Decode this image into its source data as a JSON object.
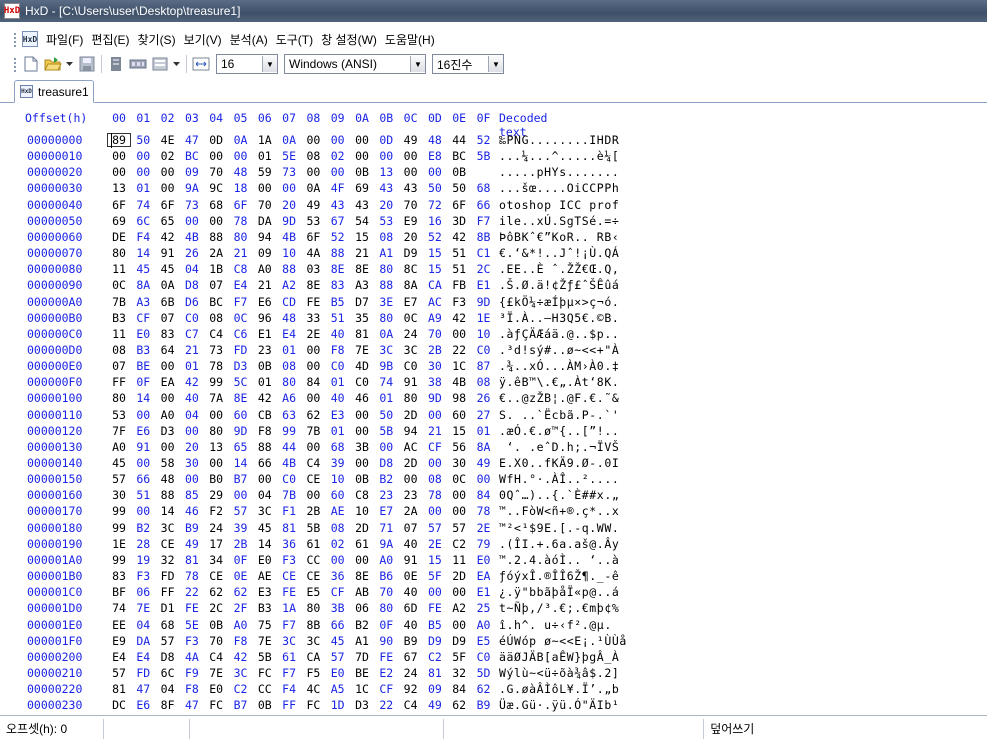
{
  "window": {
    "title": "HxD - [C:\\Users\\user\\Desktop\\treasure1]",
    "app_icon_text": "HxD"
  },
  "menu": {
    "icon_text": "HxD",
    "items": [
      "파일(F)",
      "편집(E)",
      "찾기(S)",
      "보기(V)",
      "분석(A)",
      "도구(T)",
      "창 설정(W)",
      "도움말(H)"
    ]
  },
  "toolbar": {
    "bytes_per_row": "16",
    "charset": "Windows (ANSI)",
    "number_base": "16진수"
  },
  "tabs": [
    {
      "label": "treasure1"
    }
  ],
  "editor": {
    "header": {
      "offset_label": "Offset(h)",
      "columns": [
        "00",
        "01",
        "02",
        "03",
        "04",
        "05",
        "06",
        "07",
        "08",
        "09",
        "0A",
        "0B",
        "0C",
        "0D",
        "0E",
        "0F"
      ],
      "decoded_label": "Decoded text"
    },
    "rows": [
      {
        "offset": "00000000",
        "bytes": "89 50 4E 47 0D 0A 1A 0A 00 00 00 0D 49 48 44 52",
        "text": "‰PNG........IHDR"
      },
      {
        "offset": "00000010",
        "bytes": "00 00 02 BC 00 00 01 5E 08 02 00 00 00 E8 BC 5B",
        "text": "...¼...^.....è¼["
      },
      {
        "offset": "00000020",
        "bytes": "00 00 00 09 70 48 59 73 00 00 0B 13 00 00 0B",
        "text": ".....pHYs......."
      },
      {
        "offset": "00000030",
        "bytes": "13 01 00 9A 9C 18 00 00 0A 4F 69 43 43 50 50 68",
        "text": "...šœ....OiCCPPh"
      },
      {
        "offset": "00000040",
        "bytes": "6F 74 6F 73 68 6F 70 20 49 43 43 20 70 72 6F 66",
        "text": "otoshop ICC prof"
      },
      {
        "offset": "00000050",
        "bytes": "69 6C 65 00 00 78 DA 9D 53 67 54 53 E9 16 3D F7",
        "text": "ile..xÚ.SgTSé.=÷"
      },
      {
        "offset": "00000060",
        "bytes": "DE F4 42 4B 88 80 94 4B 6F 52 15 08 20 52 42 8B",
        "text": "ÞôBKˆ€”KoR.. RB‹"
      },
      {
        "offset": "00000070",
        "bytes": "80 14 91 26 2A 21 09 10 4A 88 21 A1 D9 15 51 C1",
        "text": "€.‘&*!..Jˆ!¡Ù.QÁ"
      },
      {
        "offset": "00000080",
        "bytes": "11 45 45 04 1B C8 A0 88 03 8E 8E 80 8C 15 51 2C",
        "text": ".EE..È ˆ.ŽŽ€Œ.Q,"
      },
      {
        "offset": "00000090",
        "bytes": "0C 8A 0A D8 07 E4 21 A2 8E 83 A3 88 8A CA FB E1",
        "text": ".Š.Ø.ä!¢Žƒ£ˆŠÊûá"
      },
      {
        "offset": "000000A0",
        "bytes": "7B A3 6B D6 BC F7 E6 CD FE B5 D7 3E E7 AC F3 9D",
        "text": "{£kÖ¼÷æÍþµ×>ç¬ó."
      },
      {
        "offset": "000000B0",
        "bytes": "B3 CF 07 C0 08 0C 96 48 33 51 35 80 0C A9 42 1E",
        "text": "³Ï.À..–H3Q5€.©B."
      },
      {
        "offset": "000000C0",
        "bytes": "11 E0 83 C7 C4 C6 E1 E4 2E 40 81 0A 24 70 00 10",
        "text": ".àƒÇÄÆáä.@..$p.."
      },
      {
        "offset": "000000D0",
        "bytes": "08 B3 64 21 73 FD 23 01 00 F8 7E 3C 3C 2B 22 C0",
        "text": ".³d!sý#..ø~<<+\"À"
      },
      {
        "offset": "000000E0",
        "bytes": "07 BE 00 01 78 D3 0B 08 00 C0 4D 9B C0 30 1C 87",
        "text": ".¾..xÓ...ÀM›À0.‡"
      },
      {
        "offset": "000000F0",
        "bytes": "FF 0F EA 42 99 5C 01 80 84 01 C0 74 91 38 4B 08",
        "text": "ÿ.êB™\\.€„.Àt‘8K."
      },
      {
        "offset": "00000100",
        "bytes": "80 14 00 40 7A 8E 42 A6 00 40 46 01 80 9D 98 26",
        "text": "€..@zŽB¦.@F.€.˜&"
      },
      {
        "offset": "00000110",
        "bytes": "53 00 A0 04 00 60 CB 63 62 E3 00 50 2D 00 60 27",
        "text": "S. ..`Ëcbã.P-.`'"
      },
      {
        "offset": "00000120",
        "bytes": "7F E6 D3 00 80 9D F8 99 7B 01 00 5B 94 21 15 01",
        "text": ".æÓ.€.ø™{..[”!.."
      },
      {
        "offset": "00000130",
        "bytes": "A0 91 00 20 13 65 88 44 00 68 3B 00 AC CF 56 8A",
        "text": " ‘. .eˆD.h;.¬ÏVŠ"
      },
      {
        "offset": "00000140",
        "bytes": "45 00 58 30 00 14 66 4B C4 39 00 D8 2D 00 30 49",
        "text": "E.X0..fKÄ9.Ø-.0I"
      },
      {
        "offset": "00000150",
        "bytes": "57 66 48 00 B0 B7 00 C0 CE 10 0B B2 00 08 0C 00",
        "text": "WfH.°·.ÀÎ..²...."
      },
      {
        "offset": "00000160",
        "bytes": "30 51 88 85 29 00 04 7B 00 60 C8 23 23 78 00 84",
        "text": "0Qˆ…)..{.`È##x.„"
      },
      {
        "offset": "00000170",
        "bytes": "99 00 14 46 F2 57 3C F1 2B AE 10 E7 2A 00 00 78",
        "text": "™..FòW<ñ+®.ç*..x"
      },
      {
        "offset": "00000180",
        "bytes": "99 B2 3C B9 24 39 45 81 5B 08 2D 71 07 57 57 2E",
        "text": "™²<¹$9E.[.-q.WW."
      },
      {
        "offset": "00000190",
        "bytes": "1E 28 CE 49 17 2B 14 36 61 02 61 9A 40 2E C2 79",
        "text": ".(ÎI.+.6a.aš@.Ây"
      },
      {
        "offset": "000001A0",
        "bytes": "99 19 32 81 34 0F E0 F3 CC 00 00 A0 91 15 11 E0",
        "text": "™.2.4.àóÌ.. ‘..à"
      },
      {
        "offset": "000001B0",
        "bytes": "83 F3 FD 78 CE 0E AE CE CE 36 8E B6 0E 5F 2D EA",
        "text": "ƒóýxÎ.®ÎÎ6Ž¶._-ê"
      },
      {
        "offset": "000001C0",
        "bytes": "BF 06 FF 22 62 62 E3 FE E5 CF AB 70 40 00 00 E1",
        "text": "¿.ÿ\"bbãþåÏ«p@..á"
      },
      {
        "offset": "000001D0",
        "bytes": "74 7E D1 FE 2C 2F B3 1A 80 3B 06 80 6D FE A2 25",
        "text": "t~Ñþ,/³.€;.€mþ¢%"
      },
      {
        "offset": "000001E0",
        "bytes": "EE 04 68 5E 0B A0 75 F7 8B 66 B2 0F 40 B5 00 A0",
        "text": "î.h^. u÷‹f².@µ. "
      },
      {
        "offset": "000001F0",
        "bytes": "E9 DA 57 F3 70 F8 7E 3C 3C 45 A1 90 B9 D9 D9 E5",
        "text": "éÚWóp ø~<<E¡.¹ÙÙå"
      },
      {
        "offset": "00000200",
        "bytes": "E4 E4 D8 4A C4 42 5B 61 CA 57 7D FE 67 C2 5F C0",
        "text": "ääØJÄB[aÊW}þgÂ_À"
      },
      {
        "offset": "00000210",
        "bytes": "57 FD 6C F9 7E 3C FC F7 F5 E0 BE E2 24 81 32 5D",
        "text": "Wýlù~<ü÷õà¾â$.2]"
      },
      {
        "offset": "00000220",
        "bytes": "81 47 04 F8 E0 C2 CC F4 4C A5 1C CF 92 09 84 62",
        "text": ".G.øàÂÌôL¥.Ï’.„b"
      },
      {
        "offset": "00000230",
        "bytes": "DC E6 8F 47 FC B7 0B FF FC 1D D3 22 C4 49 62 B9",
        "text": "Üæ.Gü·.ÿü.Ó\"ÄIb¹"
      }
    ]
  },
  "statusbar": {
    "offset_label": "오프셋(h): 0",
    "mode": "덮어쓰기"
  }
}
